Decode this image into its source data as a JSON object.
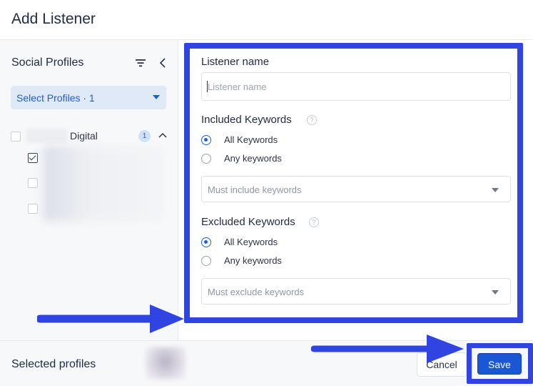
{
  "dialog": {
    "title": "Add Listener"
  },
  "sidebar": {
    "title": "Social Profiles",
    "filter_icon": "filter-icon",
    "collapse_icon": "chevron-left-icon",
    "select_profiles": "Select Profiles · 1",
    "group": {
      "name": "Digital",
      "count": "1",
      "expanded": true
    }
  },
  "form": {
    "listener_name": {
      "label": "Listener name",
      "placeholder": "Listener name",
      "value": ""
    },
    "included": {
      "label": "Included Keywords",
      "options": [
        "All Keywords",
        "Any keywords"
      ],
      "selected": "All Keywords",
      "placeholder": "Must include keywords"
    },
    "excluded": {
      "label": "Excluded Keywords",
      "options": [
        "All Keywords",
        "Any keywords"
      ],
      "selected": "All Keywords",
      "placeholder": "Must exclude keywords"
    },
    "help_glyph": "?"
  },
  "footer": {
    "selected_profiles_label": "Selected profiles",
    "cancel_label": "Cancel",
    "save_label": "Save"
  },
  "colors": {
    "accent": "#1a57d6",
    "annotation": "#2f44e0"
  }
}
